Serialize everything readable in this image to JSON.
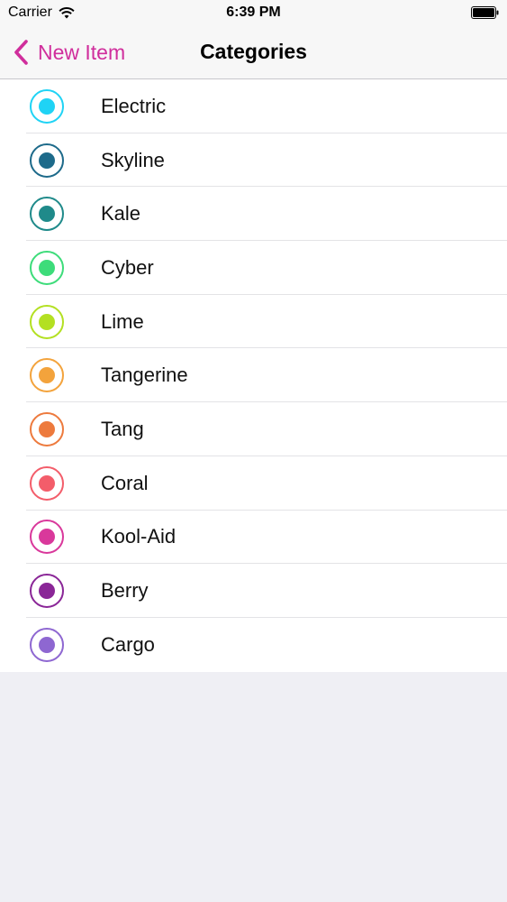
{
  "status_bar": {
    "carrier": "Carrier",
    "time": "6:39 PM"
  },
  "nav": {
    "back_label": "New Item",
    "title": "Categories"
  },
  "accent_color": "#d02e9c",
  "categories": [
    {
      "label": "Electric",
      "color": "#1fd3f5"
    },
    {
      "label": "Skyline",
      "color": "#1d6a8a"
    },
    {
      "label": "Kale",
      "color": "#1f8a8a"
    },
    {
      "label": "Cyber",
      "color": "#3ddc7a"
    },
    {
      "label": "Lime",
      "color": "#b3e022"
    },
    {
      "label": "Tangerine",
      "color": "#f3a33c"
    },
    {
      "label": "Tang",
      "color": "#ed7a3d"
    },
    {
      "label": "Coral",
      "color": "#f35d6a"
    },
    {
      "label": "Kool-Aid",
      "color": "#d9389b"
    },
    {
      "label": "Berry",
      "color": "#8a2697"
    },
    {
      "label": "Cargo",
      "color": "#8e67d1"
    }
  ]
}
